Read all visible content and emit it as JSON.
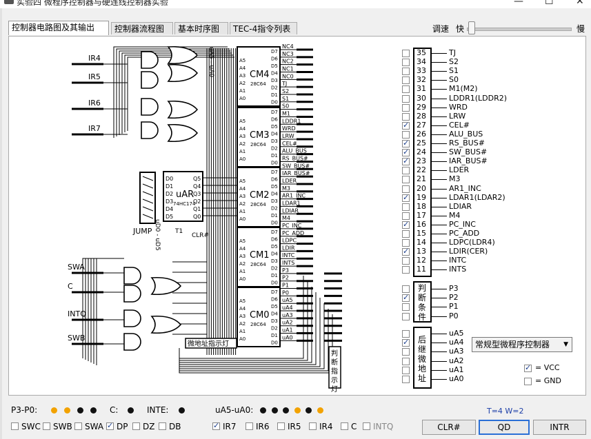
{
  "window": {
    "title": "实验四 微程序控制器与硬连线控制器实验"
  },
  "tabs": [
    "控制器电路图及其输出",
    "控制器流程图",
    "基本时序图",
    "TEC-4指令列表"
  ],
  "speed": {
    "label": "调速",
    "fast": "快",
    "slow": "慢"
  },
  "circuit": {
    "inputs": [
      "IR4",
      "IR5",
      "IR6",
      "IR7",
      "SWA",
      "C",
      "INTQ",
      "SWB"
    ],
    "chips": [
      {
        "name": "CM4",
        "part": "28C64",
        "outputs": [
          "NC4",
          "NC3",
          "NC2",
          "NC1",
          "NC0",
          "TJ",
          "S2",
          "S1",
          "S0"
        ]
      },
      {
        "name": "CM3",
        "part": "28C64",
        "outputs": [
          "M1",
          "LDDR1",
          "WRD",
          "LRW",
          "CEL#",
          "ALU_BUS",
          "RS_BUS#",
          "SW_BUS#"
        ]
      },
      {
        "name": "CM2",
        "part": "28C64",
        "outputs": [
          "IAR_BUS#",
          "LDER",
          "M3",
          "AR1_INC",
          "LDAR1",
          "LDIAR",
          "M4",
          "PC_INC"
        ]
      },
      {
        "name": "CM1",
        "part": "28C64",
        "outputs": [
          "PC_ADD",
          "LDPC",
          "LDIR",
          "INTC",
          "INTS",
          "P3",
          "P2",
          "P1"
        ]
      },
      {
        "name": "CM0",
        "part": "28C64",
        "outputs": [
          "P0",
          "uA5",
          "uA4",
          "uA3",
          "uA2",
          "uA1",
          "uA0"
        ]
      }
    ],
    "addr_pins": [
      "A5",
      "A4",
      "A3",
      "A2",
      "A1",
      "A0"
    ],
    "data_pins": [
      "D7",
      "D6",
      "D5",
      "D4",
      "D3",
      "D2",
      "D1",
      "D0"
    ],
    "uar": {
      "name": "uAR",
      "part": "74HC174",
      "d_pins": [
        "D0",
        "D1",
        "D2",
        "D3",
        "D4",
        "D5"
      ],
      "q_pins": [
        "Q5",
        "Q4",
        "Q3",
        "Q2",
        "Q1",
        "Q0"
      ],
      "t1": "T1",
      "clr": "CLR#"
    },
    "jump_label": "JUMP",
    "ud_label": "uD0 - uD5",
    "ua_label": "uA5 - uA0",
    "micro_addr_lamp": "微地址指示灯",
    "judge_lamp": "判断指示灯"
  },
  "signals": [
    {
      "num": "35",
      "name": "TJ",
      "checked": false
    },
    {
      "num": "34",
      "name": "S2",
      "checked": false
    },
    {
      "num": "33",
      "name": "S1",
      "checked": false
    },
    {
      "num": "32",
      "name": "S0",
      "checked": false
    },
    {
      "num": "31",
      "name": "M1(M2)",
      "checked": false
    },
    {
      "num": "30",
      "name": "LDDR1(LDDR2)",
      "checked": false
    },
    {
      "num": "29",
      "name": "WRD",
      "checked": false
    },
    {
      "num": "28",
      "name": "LRW",
      "checked": false
    },
    {
      "num": "27",
      "name": "CEL#",
      "checked": true
    },
    {
      "num": "26",
      "name": "ALU_BUS",
      "checked": false
    },
    {
      "num": "25",
      "name": "RS_BUS#",
      "checked": true
    },
    {
      "num": "24",
      "name": "SW_BUS#",
      "checked": true
    },
    {
      "num": "23",
      "name": "IAR_BUS#",
      "checked": true
    },
    {
      "num": "22",
      "name": "LDER",
      "checked": false
    },
    {
      "num": "21",
      "name": "M3",
      "checked": false
    },
    {
      "num": "20",
      "name": "AR1_INC",
      "checked": false
    },
    {
      "num": "19",
      "name": "LDAR1(LDAR2)",
      "checked": true
    },
    {
      "num": "18",
      "name": "LDIAR",
      "checked": false
    },
    {
      "num": "17",
      "name": "M4",
      "checked": false
    },
    {
      "num": "16",
      "name": "PC_INC",
      "checked": true
    },
    {
      "num": "15",
      "name": "PC_ADD",
      "checked": false
    },
    {
      "num": "14",
      "name": "LDPC(LDR4)",
      "checked": false
    },
    {
      "num": "13",
      "name": "LDIR(CER)",
      "checked": true
    },
    {
      "num": "12",
      "name": "INTC",
      "checked": false
    },
    {
      "num": "11",
      "name": "INTS",
      "checked": false
    }
  ],
  "judge": {
    "label": [
      "判",
      "断",
      "条",
      "件"
    ],
    "items": [
      {
        "name": "P3",
        "checked": false
      },
      {
        "name": "P2",
        "checked": true
      },
      {
        "name": "P1",
        "checked": false
      },
      {
        "name": "P0",
        "checked": false
      }
    ]
  },
  "next_addr": {
    "label": [
      "后",
      "继",
      "微",
      "地",
      "址"
    ],
    "items": [
      {
        "name": "uA5",
        "checked": false
      },
      {
        "name": "uA4",
        "checked": true
      },
      {
        "name": "uA3",
        "checked": false
      },
      {
        "name": "uA2",
        "checked": false
      },
      {
        "name": "uA1",
        "checked": false
      },
      {
        "name": "uA0",
        "checked": false
      }
    ]
  },
  "controller_select": "常规型微程序控制器",
  "power": [
    {
      "label": "= VCC",
      "checked": true
    },
    {
      "label": "= GND",
      "checked": false
    }
  ],
  "indicators": {
    "p_label": "P3-P0:",
    "p_dots": [
      "#f2a200",
      "#f2a200",
      "#111111",
      "#111111"
    ],
    "c_label": "C:",
    "c_dot": "#111111",
    "inte_label": "INTE:",
    "inte_dot": "#111111",
    "ua_label": "uA5-uA0:",
    "ua_dots": [
      "#111111",
      "#111111",
      "#111111",
      "#f2a200",
      "#111111",
      "#f2a200"
    ]
  },
  "switches": [
    {
      "name": "SWC",
      "checked": false
    },
    {
      "name": "SWB",
      "checked": false
    },
    {
      "name": "SWA",
      "checked": false
    },
    {
      "name": "DP",
      "checked": true
    },
    {
      "name": "DZ",
      "checked": false
    },
    {
      "name": "DB",
      "checked": false
    },
    {
      "name": "IR7",
      "checked": true
    },
    {
      "name": "IR6",
      "checked": false
    },
    {
      "name": "IR5",
      "checked": false
    },
    {
      "name": "IR4",
      "checked": false
    },
    {
      "name": "C",
      "checked": false
    },
    {
      "name": "INTQ",
      "checked": false
    }
  ],
  "status": "T=4 W=2",
  "buttons": {
    "clr": "CLR#",
    "qd": "QD",
    "intr": "INTR"
  }
}
